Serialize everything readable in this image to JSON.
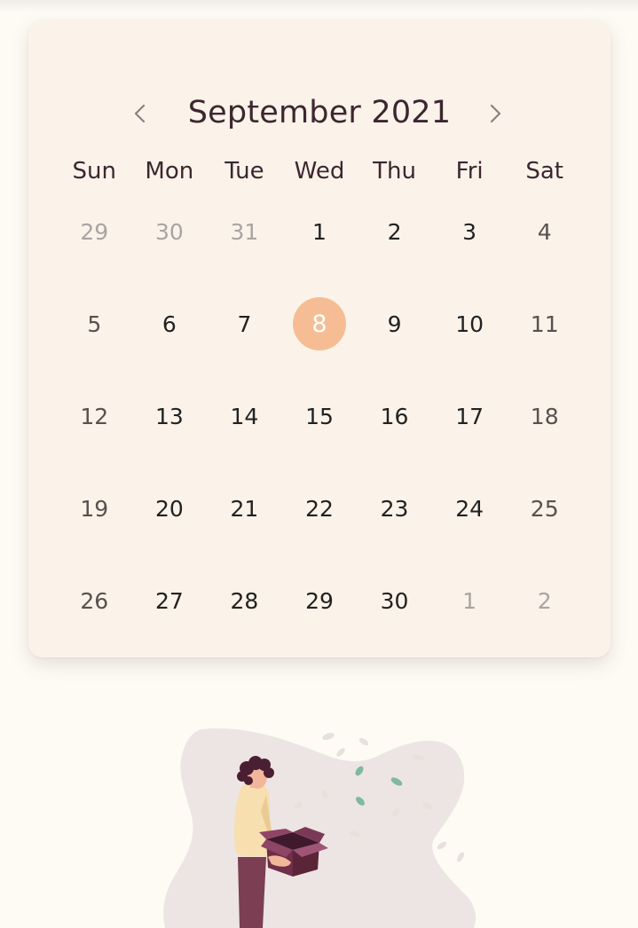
{
  "calendar": {
    "month_title": "September 2021",
    "weekdays": [
      "Sun",
      "Mon",
      "Tue",
      "Wed",
      "Thu",
      "Fri",
      "Sat"
    ],
    "weeks": [
      [
        {
          "d": "29",
          "o": true
        },
        {
          "d": "30",
          "o": true
        },
        {
          "d": "31",
          "o": true
        },
        {
          "d": "1"
        },
        {
          "d": "2"
        },
        {
          "d": "3"
        },
        {
          "d": "4"
        }
      ],
      [
        {
          "d": "5"
        },
        {
          "d": "6"
        },
        {
          "d": "7"
        },
        {
          "d": "8",
          "sel": true
        },
        {
          "d": "9"
        },
        {
          "d": "10"
        },
        {
          "d": "11"
        }
      ],
      [
        {
          "d": "12"
        },
        {
          "d": "13"
        },
        {
          "d": "14"
        },
        {
          "d": "15"
        },
        {
          "d": "16"
        },
        {
          "d": "17"
        },
        {
          "d": "18"
        }
      ],
      [
        {
          "d": "19"
        },
        {
          "d": "20"
        },
        {
          "d": "21"
        },
        {
          "d": "22"
        },
        {
          "d": "23"
        },
        {
          "d": "24"
        },
        {
          "d": "25"
        }
      ],
      [
        {
          "d": "26"
        },
        {
          "d": "27"
        },
        {
          "d": "28"
        },
        {
          "d": "29"
        },
        {
          "d": "30"
        },
        {
          "d": "1",
          "o": true
        },
        {
          "d": "2",
          "o": true
        }
      ]
    ],
    "prev_icon": "chevron-left-icon",
    "next_icon": "chevron-right-icon"
  },
  "colors": {
    "page_background": "#fefbf5",
    "card_background": "#fbf3ea",
    "selected_day": "#f6bd94",
    "title_text": "#3d2630"
  }
}
